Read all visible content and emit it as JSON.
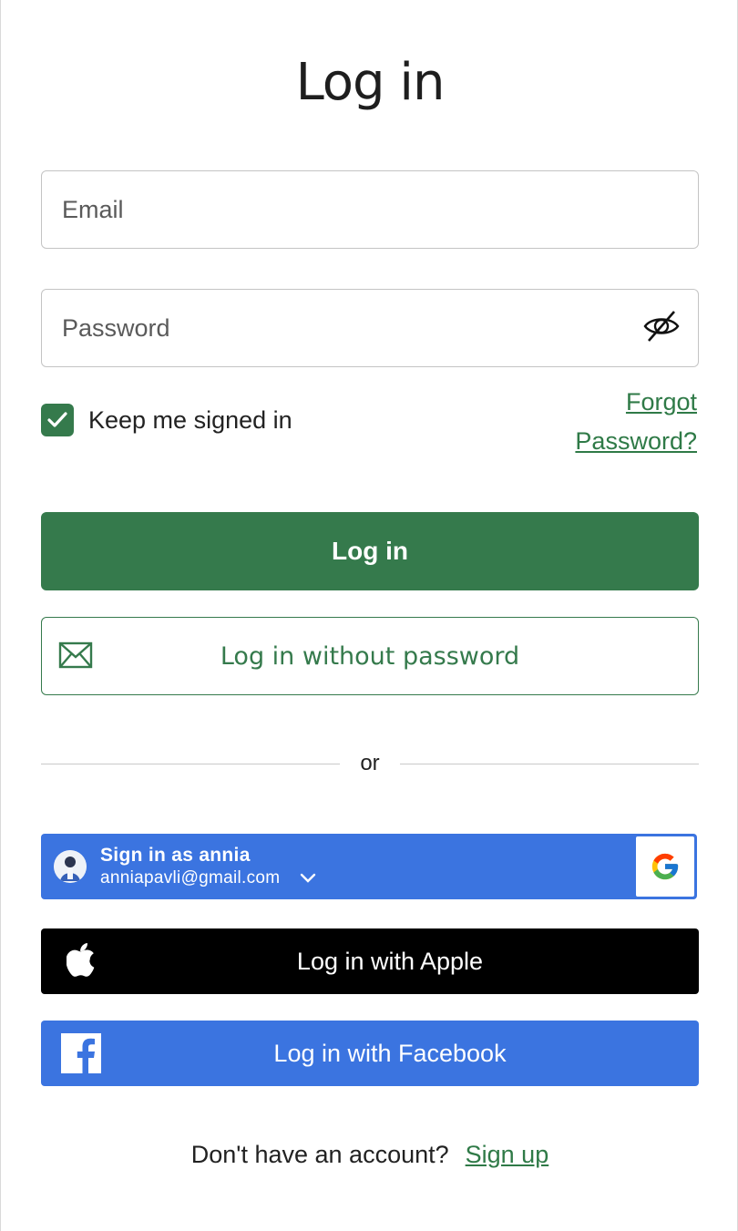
{
  "page": {
    "title": "Log in"
  },
  "form": {
    "email_placeholder": "Email",
    "email_value": "",
    "password_placeholder": "Password",
    "password_value": "",
    "keep_signed_in_label": "Keep me signed in",
    "keep_signed_in_checked": true,
    "forgot_line1": "Forgot",
    "forgot_line2": "Password?"
  },
  "buttons": {
    "login_label": "Log in",
    "passwordless_label": "Log in without password"
  },
  "divider": {
    "label": "or"
  },
  "google": {
    "name_line": "Sign in as annia",
    "email": "anniapavli@gmail.com"
  },
  "apple": {
    "label": "Log in with Apple"
  },
  "facebook": {
    "label": "Log in with Facebook"
  },
  "footer": {
    "prompt": "Don't have an account?",
    "signup_label": "Sign up"
  },
  "icons": {
    "eye": "eye-slash-icon",
    "check": "checkmark-icon",
    "mail": "envelope-icon",
    "chevron": "chevron-down-icon",
    "google": "google-logo-icon",
    "apple": "apple-logo-icon",
    "facebook": "facebook-logo-icon"
  },
  "colors": {
    "primary_green": "#357a4c",
    "link_green": "#2f7a47",
    "google_blue": "#3b74e0",
    "facebook_blue": "#3b74e0",
    "apple_black": "#000000"
  }
}
